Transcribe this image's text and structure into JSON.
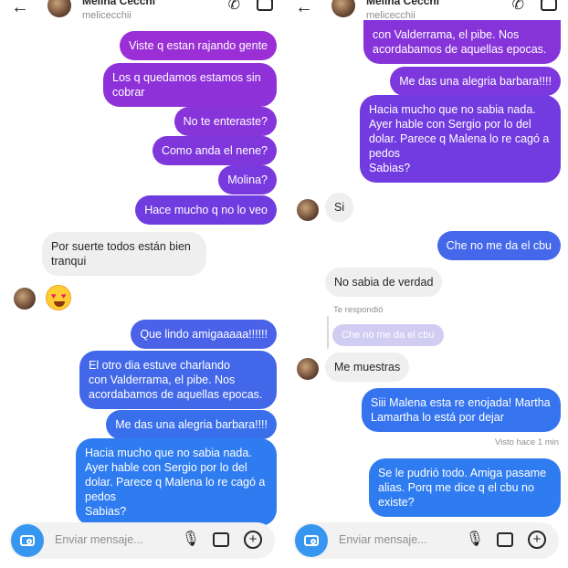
{
  "left": {
    "header": {
      "name": "Melina Cecchi",
      "username": "melicecchii"
    },
    "messages": {
      "o1": "Viste q  estan rajando gente",
      "o2": "Los q quedamos estamos sin\ncobrar",
      "o3": "No te enteraste?",
      "o4": "Como anda el nene?",
      "o5": "Molina?",
      "o6": "Hace mucho q no lo veo",
      "i1": "Por suerte todos están bien\ntranqui",
      "o7": "Que lindo amigaaaaa!!!!!!",
      "o8": "El otro dia estuve charlando\ncon Valderrama, el pibe. Nos\nacordabamos de aquellas epocas.",
      "o9": "Me das una alegria barbara!!!!",
      "o10": "Hacia mucho que no sabia nada.\nAyer hable con Sergio por lo del\ndolar. Parece q Malena lo re cagó a\npedos\n Sabias?"
    },
    "composer": {
      "placeholder": "Enviar mensaje..."
    }
  },
  "right": {
    "header": {
      "name": "Melina Cecchi",
      "username": "melicecchii"
    },
    "messages": {
      "o1": "con Valderrama, el pibe. Nos\nacordabamos de aquellas epocas.",
      "o2": "Me das una alegria barbara!!!!",
      "o3": "Hacia mucho que no sabia nada.\nAyer hable con Sergio por lo del\ndolar. Parece q Malena lo re cagó a\npedos\n Sabias?",
      "i1": "Si",
      "o4": "Che no me da el cbu",
      "i2": "No sabia de verdad",
      "reply_label": "Te respondió",
      "reply_quote": "Che no me da el cbu",
      "i3": "Me muestras",
      "o5": "Siii Malena esta re enojada! Martha\nLamartha lo está por dejar",
      "seen": "Visto hace 1 min",
      "o6": "Se le pudrió todo. Amiga pasame\nalias. Porq me dice q el cbu no\nexiste?"
    },
    "composer": {
      "placeholder": "Enviar mensaje..."
    }
  },
  "icons": [
    "back-arrow-icon",
    "phone-icon",
    "video-icon",
    "camera-icon",
    "microphone-icon",
    "image-icon",
    "plus-icon",
    "heart-eyes-emoji-icon"
  ],
  "colors": {
    "purple": "#8a2be2",
    "violet": "#6f3ce6",
    "indigo": "#4a5ae8",
    "blue": "#2f7cf0",
    "incoming": "#efefef"
  }
}
